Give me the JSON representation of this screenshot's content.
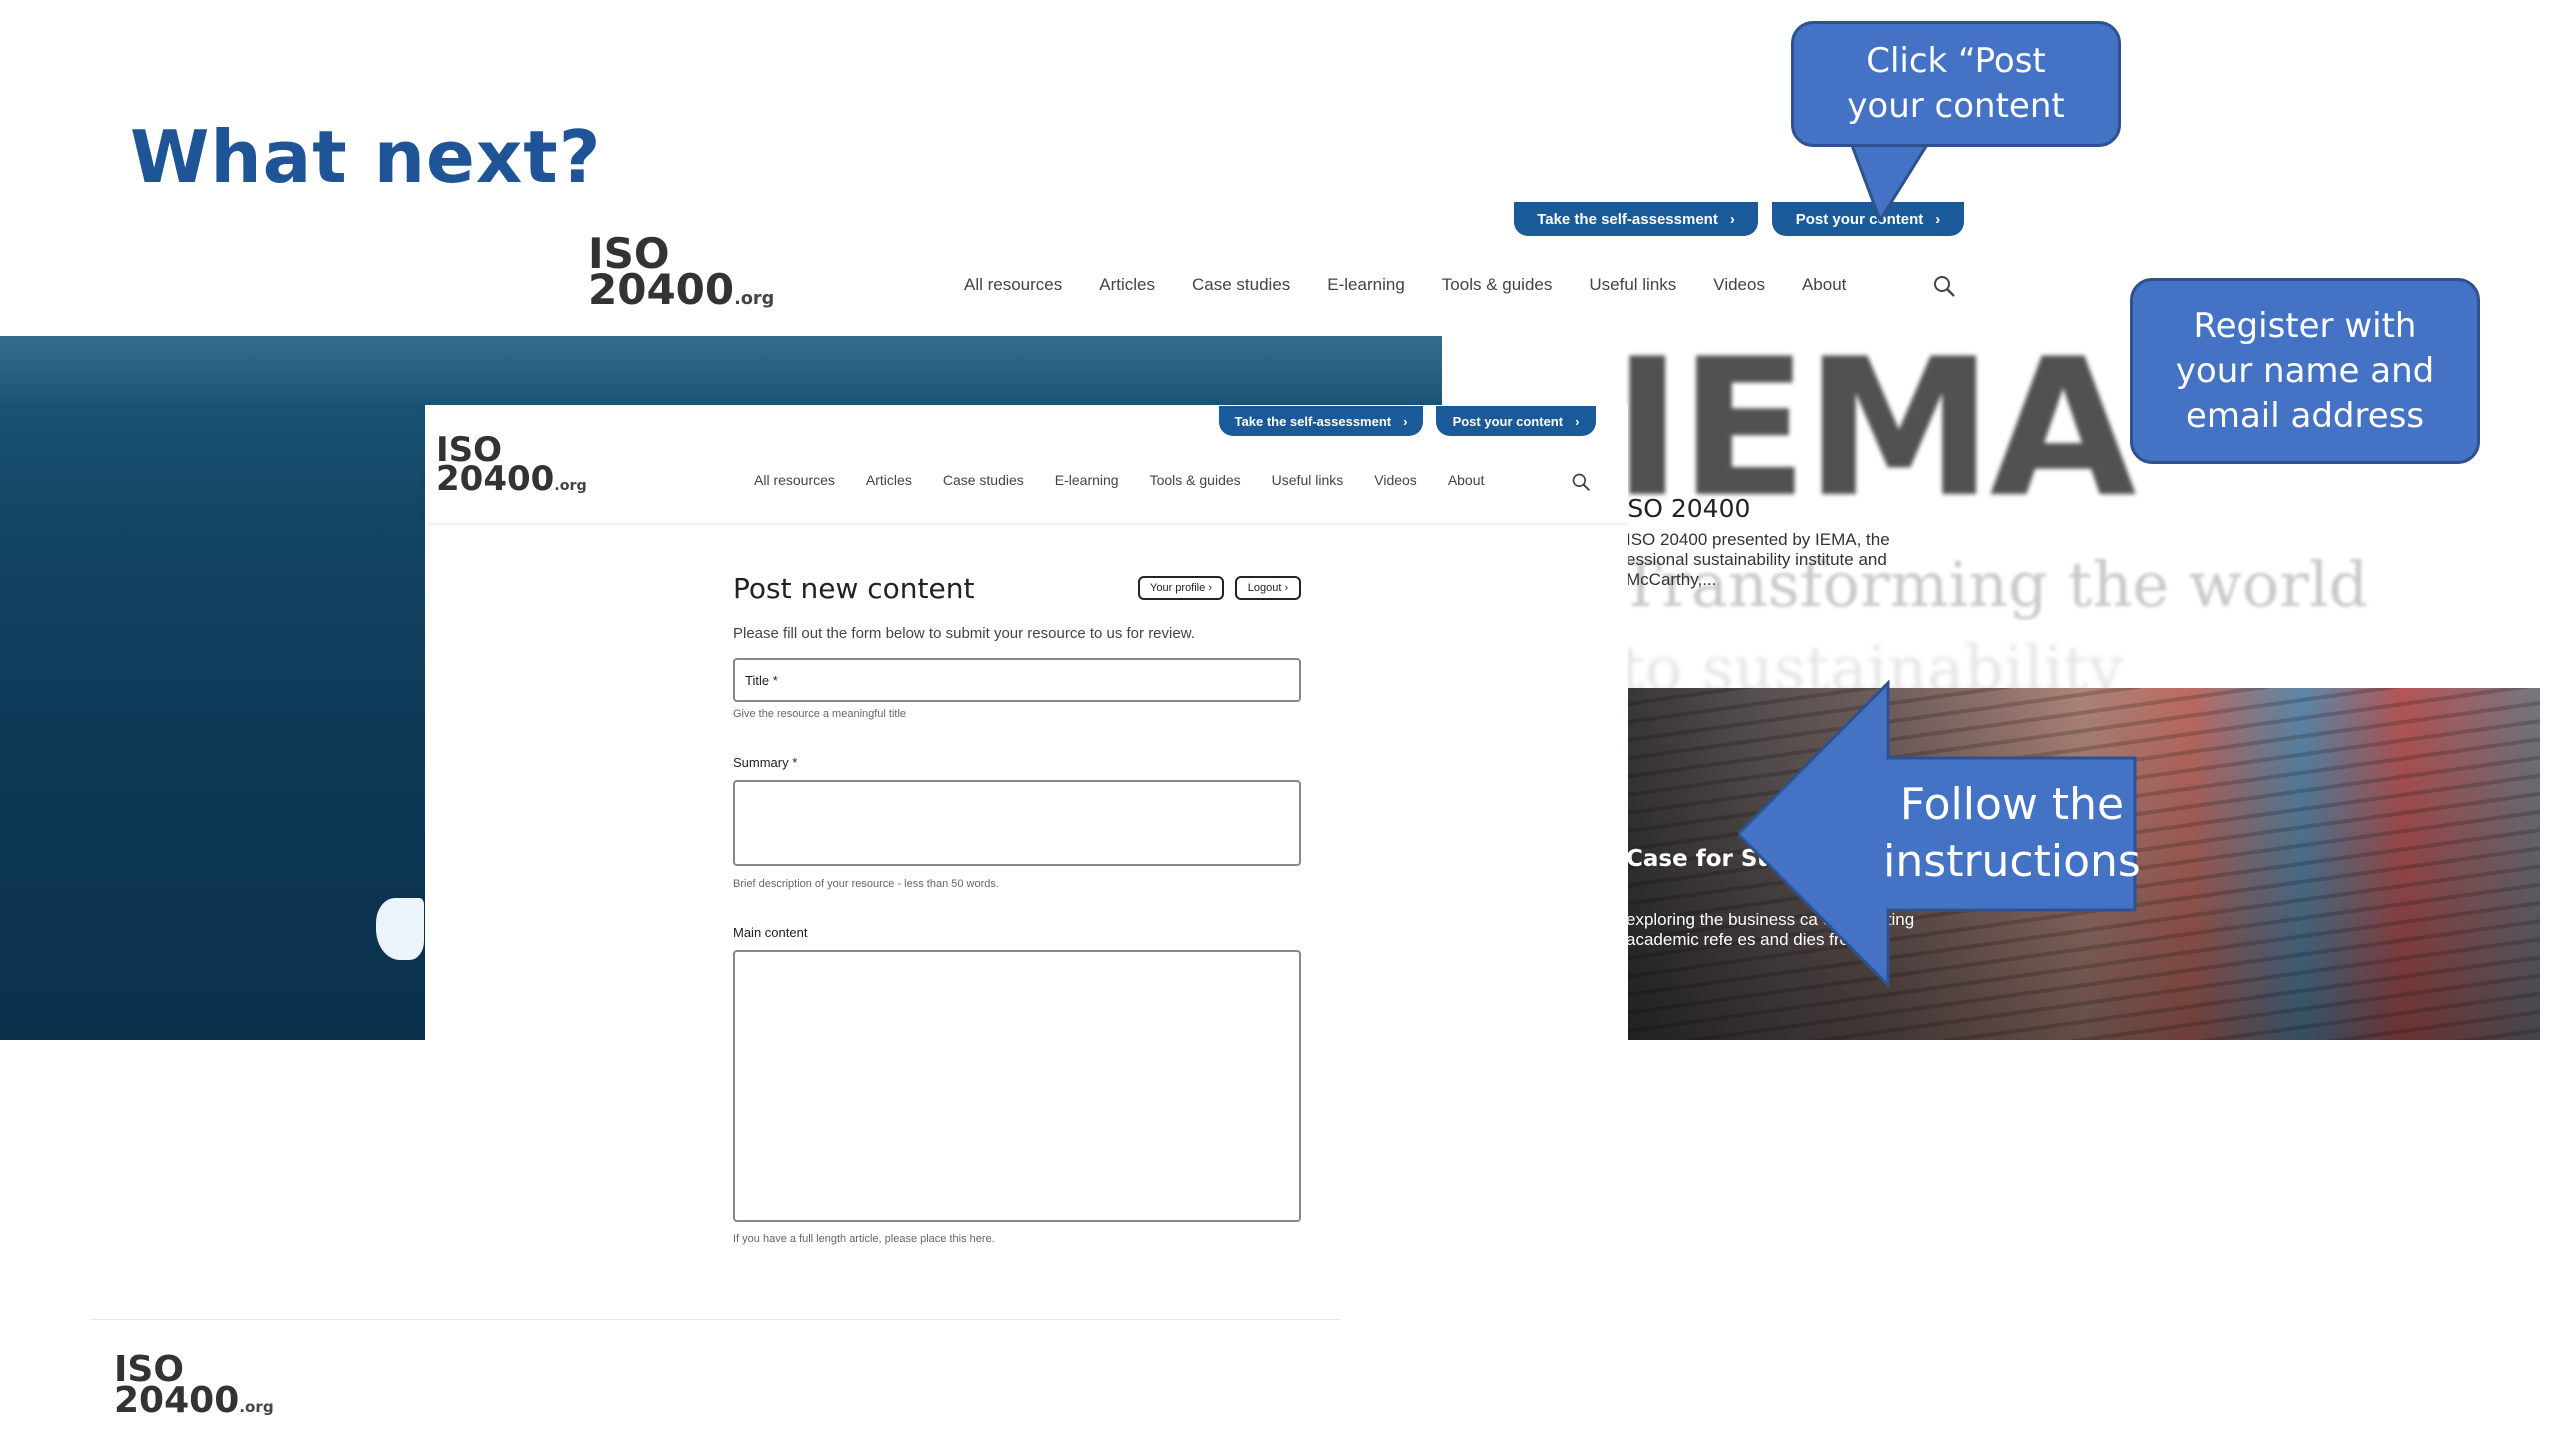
{
  "slide": {
    "title": "What next?"
  },
  "logo": {
    "line1": "ISO",
    "line2": "20400",
    "suffix": ".org"
  },
  "site_nav": {
    "items": [
      "All resources",
      "Articles",
      "Case studies",
      "E-learning",
      "Tools & guides",
      "Useful links",
      "Videos",
      "About"
    ],
    "self_assessment": "Take the self-assessment",
    "post_content": "Post your content",
    "chevron": "›",
    "search_icon": "search-icon"
  },
  "background_page": {
    "banner_text": "IEMA",
    "article1": {
      "title": "ISO 20400",
      "desc": "ISO 20400 presented by IEMA, the essional sustainability institute and McCarthy,..."
    },
    "tagline1": "Transforming the world",
    "tagline2": "to sustainability",
    "article2": {
      "title": "Case for Sus",
      "desc": "exploring the business ca ement citing academic refe es and dies from..."
    }
  },
  "form": {
    "heading": "Post new content",
    "your_profile": "Your profile",
    "logout": "Logout",
    "intro": "Please fill out the form below to submit your resource to us for review.",
    "title_placeholder": "Title *",
    "title_hint": "Give the resource a meaningful title",
    "summary_label": "Summary *",
    "summary_hint": "Brief description of your resource - less than 50 words.",
    "main_label": "Main content",
    "main_hint": "If you have a full length article, please place this here."
  },
  "callouts": {
    "post": "Click “Post your content",
    "register": "Register with your name and email address",
    "follow": "Follow the instructions"
  },
  "colors": {
    "title": "#1f5596",
    "callout_fill": "#4472c4",
    "callout_border": "#2f528f",
    "site_blue": "#1b5a99"
  }
}
